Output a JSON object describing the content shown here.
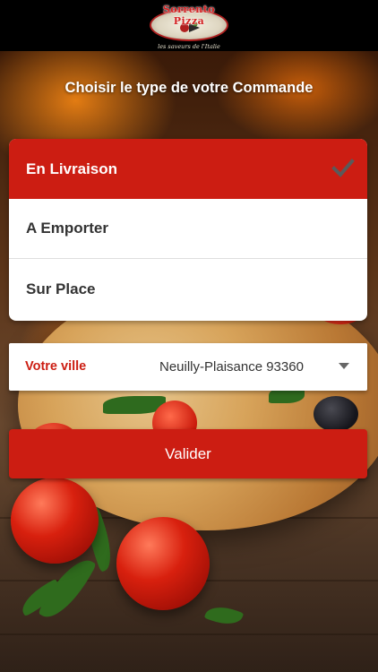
{
  "header": {
    "logo_name": "Sorrento Pizza",
    "logo_tagline": "les saveurs de l'Italie"
  },
  "page_title": "Choisir le type de votre Commande",
  "order_types": [
    {
      "label": "En Livraison",
      "selected": true
    },
    {
      "label": "A Emporter",
      "selected": false
    },
    {
      "label": "Sur Place",
      "selected": false
    }
  ],
  "city": {
    "label": "Votre ville",
    "value": "Neuilly-Plaisance 93360"
  },
  "submit_label": "Valider",
  "colors": {
    "accent": "#cc1d12",
    "text_dark": "#333333",
    "card": "#ffffff"
  },
  "icons": {
    "selected": "checkmark-icon",
    "dropdown": "caret-down-icon"
  }
}
